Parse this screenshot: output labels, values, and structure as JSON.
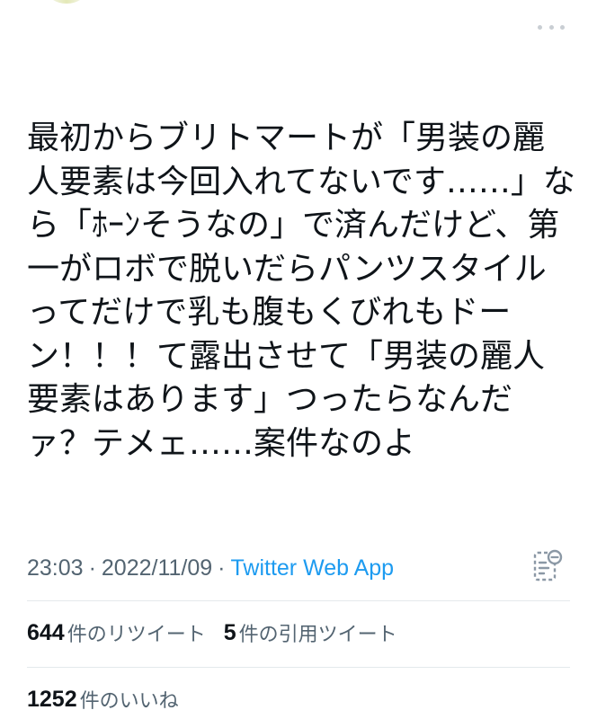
{
  "tweet": {
    "text_lines": [
      "最初からブリトマートが「男装の麗",
      "人要素は今回入れてないです……」な",
      "ら「ﾎｰﾝそうなの」で済んだけど、第",
      "一がロボで脱いだらパンツスタイル",
      "ってだけで乳も腹もくびれもドー",
      "ン！！！て露出させて「男装の麗人",
      "要素はあります」つったらなんだ",
      "ァ？テメェ……案件なのよ"
    ],
    "time": "23:03",
    "date": "2022/11/09",
    "separator": "·",
    "source": "Twitter Web App"
  },
  "stats": {
    "retweets_count": "644",
    "retweets_label": "件のリツイート",
    "quotes_count": "5",
    "quotes_label": "件の引用ツイート",
    "likes_count": "1252",
    "likes_label": "件のいいね"
  },
  "colors": {
    "text": "#0f1419",
    "muted": "#536471",
    "link": "#1d9bf0",
    "divider": "#e4e9ec"
  },
  "icons": {
    "more": "more-horizontal-icon",
    "analytics": "analytics-icon"
  }
}
